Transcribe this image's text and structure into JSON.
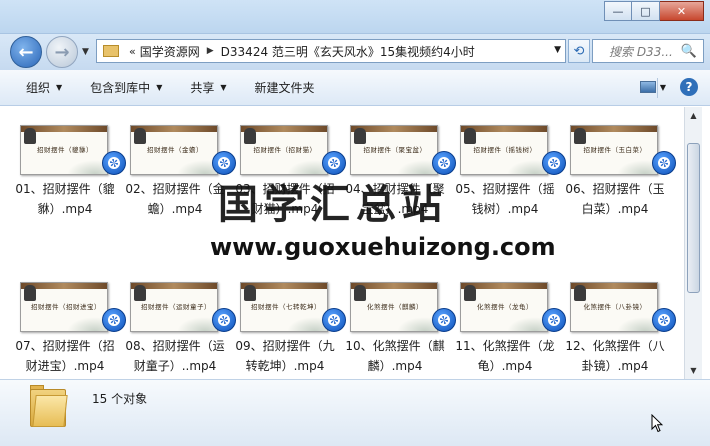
{
  "window": {
    "controls": [
      "minimize",
      "maximize",
      "close"
    ],
    "control_glyphs": [
      "—",
      "□",
      "✕"
    ]
  },
  "nav": {
    "back_glyph": "←",
    "forward_glyph": "→",
    "address_prefix": "«",
    "breadcrumb": [
      "国学资源网",
      "D33424 范三明《玄天风水》15集视频约4小时"
    ],
    "refresh_glyph": "⟲",
    "search_placeholder": "搜索 D33...",
    "search_glyph": "🔍"
  },
  "toolbar": {
    "organize": "组织",
    "include_in_library": "包含到库中",
    "share": "共享",
    "new_folder": "新建文件夹",
    "help_glyph": "?"
  },
  "files": [
    {
      "name": "01、招财摆件（貔貅）.mp4",
      "thumb_title": "招财摆件（貔貅）"
    },
    {
      "name": "02、招财摆件（金蟾）.mp4",
      "thumb_title": "招财摆件（金蟾）"
    },
    {
      "name": "03、招财摆件（招财猫）.mp4",
      "thumb_title": "招财摆件（招财猫）"
    },
    {
      "name": "04、招财摆件（聚宝盆）.mp4",
      "thumb_title": "招财摆件（聚宝盆）"
    },
    {
      "name": "05、招财摆件（摇钱树）.mp4",
      "thumb_title": "招财摆件（摇钱树）"
    },
    {
      "name": "06、招财摆件（玉白菜）.mp4",
      "thumb_title": "招财摆件（玉白菜）"
    },
    {
      "name": "07、招财摆件（招财进宝）.mp4",
      "thumb_title": "招财摆件（招财进宝）"
    },
    {
      "name": "08、招财摆件（运财童子）..mp4",
      "thumb_title": "招财摆件（运财童子）"
    },
    {
      "name": "09、招财摆件（九转乾坤）.mp4",
      "thumb_title": "招财摆件（七转乾坤）"
    },
    {
      "name": "10、化煞摆件（麒麟）.mp4",
      "thumb_title": "化煞摆件（麒麟）"
    },
    {
      "name": "11、化煞摆件（龙龟）.mp4",
      "thumb_title": "化煞摆件（龙龟）"
    },
    {
      "name": "12、化煞摆件（八卦镜）.mp4",
      "thumb_title": "化煞摆件（八卦镜）"
    }
  ],
  "watermark": {
    "cn": "国学汇总站",
    "url": "www.guoxuehuizong.com"
  },
  "status": {
    "count_text": "15 个对象"
  },
  "colors": {
    "toolbar_bg": "#dde9f6",
    "badge": "#0b4fb8",
    "close_button": "#c7472e"
  }
}
